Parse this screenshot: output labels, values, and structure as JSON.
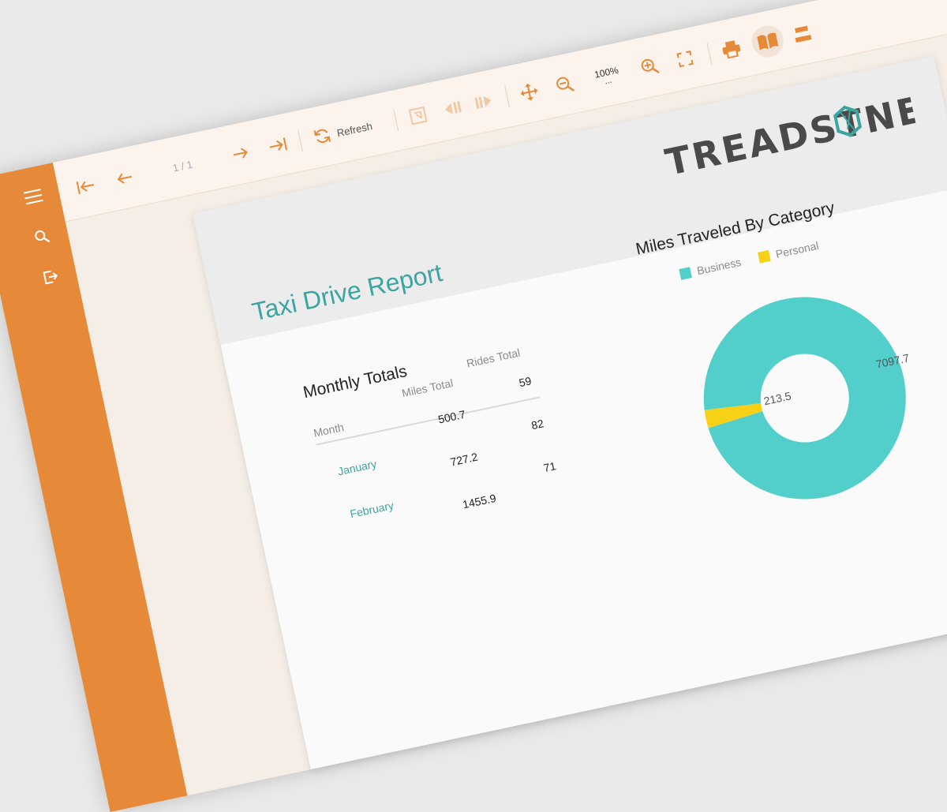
{
  "toolbar": {
    "page_indicator": "1 / 1",
    "refresh_label": "Refresh",
    "zoom_level": "100%",
    "zoom_more": "..."
  },
  "report": {
    "title": "Taxi Drive Report",
    "logo_text": "TREADSTNE"
  },
  "table": {
    "title": "Monthly Totals",
    "headers": [
      "Month",
      "Miles Total",
      "Rides Total"
    ],
    "rows": [
      {
        "month": "January",
        "miles": "500.7",
        "rides": "59"
      },
      {
        "month": "February",
        "miles": "727.2",
        "rides": "82"
      },
      {
        "month": "",
        "miles": "1455.9",
        "rides": "71"
      }
    ]
  },
  "chart_data": {
    "type": "pie",
    "title": "Miles Traveled By Category",
    "categories": [
      "Business",
      "Personal"
    ],
    "values": [
      7097.7,
      213.5
    ],
    "labels": [
      "7097.7",
      "213.5"
    ],
    "colors": [
      "#52cfcb",
      "#f7d117"
    ],
    "legend_placement": "top"
  },
  "colors": {
    "accent": "#e68a3a",
    "title_teal": "#3aa5a1"
  }
}
